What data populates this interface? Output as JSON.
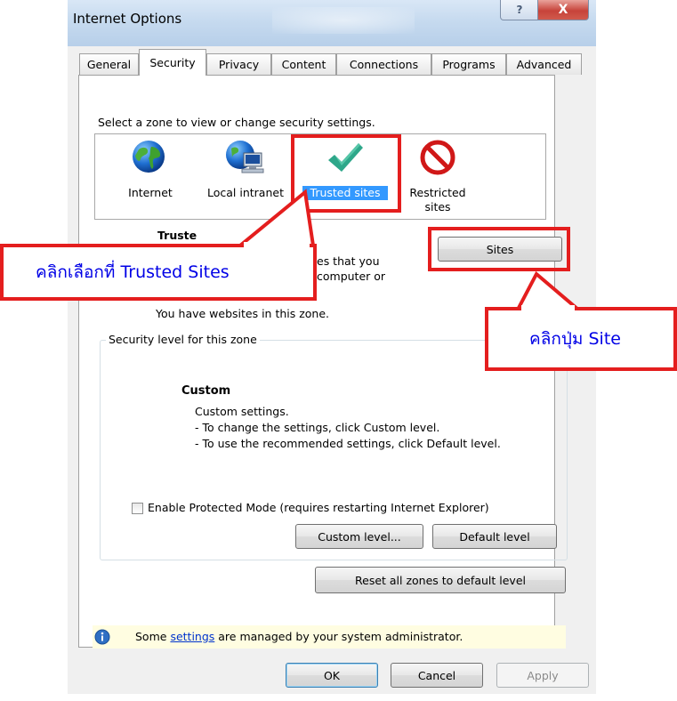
{
  "window": {
    "title": "Internet Options",
    "help_glyph": "?",
    "close_glyph": "X"
  },
  "tabs": [
    "General",
    "Security",
    "Privacy",
    "Content",
    "Connections",
    "Programs",
    "Advanced"
  ],
  "active_tab": "Security",
  "security": {
    "zone_prompt": "Select a zone to view or change security settings.",
    "zones": [
      {
        "label": "Internet",
        "icon": "globe-icon"
      },
      {
        "label": "Local intranet",
        "icon": "intranet-icon"
      },
      {
        "label": "Trusted sites",
        "icon": "checkmark-icon",
        "selected": true
      },
      {
        "label_line1": "Restricted",
        "label_line2": "sites",
        "icon": "restricted-icon"
      }
    ],
    "zone_heading_partial": "Truste",
    "zone_desc_line1_partial": "es that you",
    "zone_desc_line2_partial": "computer or",
    "zone_status": "You have websites in this zone.",
    "sites_button": "Sites",
    "level_group_title": "Security level for this zone",
    "level_name": "Custom",
    "level_lines": [
      "Custom settings.",
      "- To change the settings, click Custom level.",
      "- To use the recommended settings, click Default level."
    ],
    "protected_mode_label": "Enable Protected Mode (requires restarting Internet Explorer)",
    "protected_mode_checked": false,
    "custom_level_button": "Custom level...",
    "default_level_button": "Default level",
    "reset_all_button": "Reset all zones to default level",
    "info_prefix": "Some ",
    "info_link": "settings",
    "info_suffix": " are managed by your system administrator."
  },
  "footer": {
    "ok": "OK",
    "cancel": "Cancel",
    "apply": "Apply"
  },
  "annotations": {
    "callout_trusted": "คลิกเลือกที่ Trusted Sites",
    "callout_site": "คลิกปุ่ม Site",
    "highlight_color": "#e41e1e",
    "text_color": "#0000e6"
  }
}
